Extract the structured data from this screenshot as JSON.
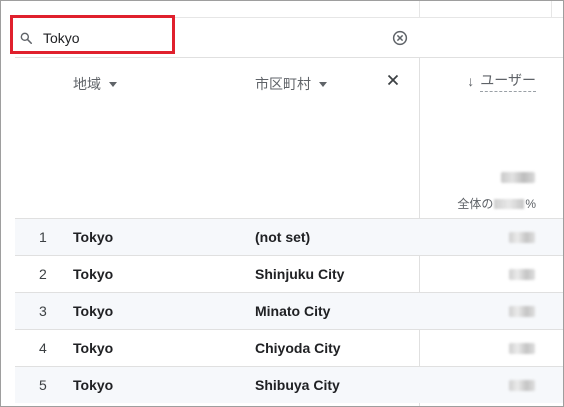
{
  "search": {
    "value": "Tokyo",
    "placeholder": ""
  },
  "columns": {
    "region": "地域",
    "city": "市区町村",
    "metric": "ユーザー",
    "percent_prefix": "全体の",
    "percent_suffix": "%"
  },
  "rows": [
    {
      "index": "1",
      "region": "Tokyo",
      "city": "(not set)"
    },
    {
      "index": "2",
      "region": "Tokyo",
      "city": "Shinjuku City"
    },
    {
      "index": "3",
      "region": "Tokyo",
      "city": "Minato City"
    },
    {
      "index": "4",
      "region": "Tokyo",
      "city": "Chiyoda City"
    },
    {
      "index": "5",
      "region": "Tokyo",
      "city": "Shibuya City"
    }
  ],
  "icons": {
    "search": "search-icon",
    "clear": "clear-circle-icon",
    "remove_dimension": "close-icon",
    "sort": "arrow-down-icon",
    "dropdown": "caret-down-icon"
  },
  "colors": {
    "highlight": "#e0202d"
  }
}
